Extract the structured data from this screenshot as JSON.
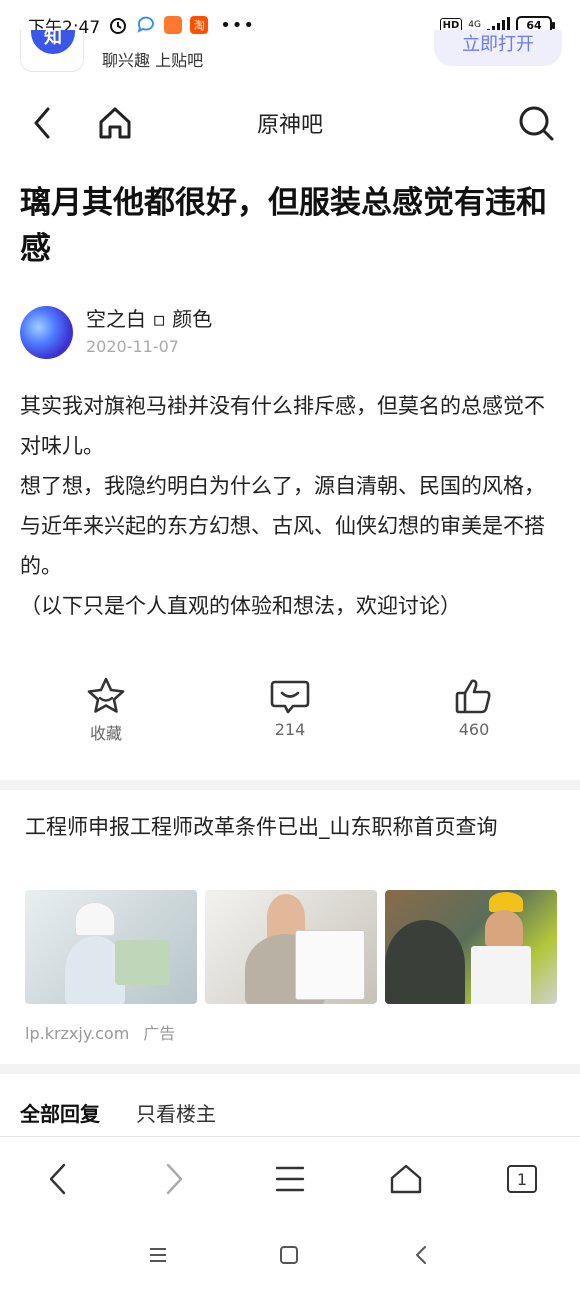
{
  "status_bar": {
    "time": "下午2:47",
    "taobao_label": "淘",
    "hd": "HD",
    "network": "4G",
    "battery": "64"
  },
  "banner": {
    "logo_text": "知",
    "slogan": "聊兴趣 上贴吧",
    "open_button": "立即打开"
  },
  "nav": {
    "title": "原神吧"
  },
  "post": {
    "title": "璃月其他都很好，但服装总感觉有违和感",
    "author": "空之白 ▫ 颜色",
    "date": "2020-11-07",
    "content": [
      "其实我对旗袍马褂并没有什么排斥感，但莫名的总感觉不对味儿。",
      "想了想，我隐约明白为什么了，源自清朝、民国的风格，与近年来兴起的东方幻想、古风、仙侠幻想的审美是不搭的。",
      "（以下只是个人直观的体验和想法，欢迎讨论）"
    ]
  },
  "actions": {
    "favorite_label": "收藏",
    "comment_count": "214",
    "like_count": "460"
  },
  "ad": {
    "title": "工程师申报工程师改革条件已出_山东职称首页查询",
    "source": "lp.krzxjy.com",
    "tag": "广告"
  },
  "replies": {
    "tab_all": "全部回复",
    "tab_op": "只看楼主"
  },
  "bottom_bar": {
    "tab_count": "1"
  },
  "colors": {
    "accent": "#6c7bf0",
    "brand_blue": "#3a57e8",
    "icon": "#333333"
  }
}
